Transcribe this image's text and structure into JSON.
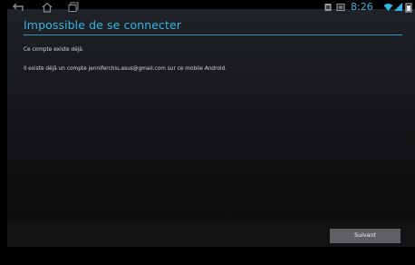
{
  "dialog": {
    "title": "Impossible de se connecter",
    "message_1": "Ce compte existe déjà.",
    "message_2": "Il existe déjà un compte jenniferchiu.asus@gmail.com sur ce mobile Android.",
    "next_button": "Suivant"
  },
  "status_bar": {
    "time": "8:26"
  },
  "colors": {
    "accent": "#33b5e5",
    "background": "#17191c",
    "button": "#5f6164"
  },
  "icons": [
    "back-icon",
    "home-icon",
    "recent-apps-icon",
    "notification-icon",
    "screenshot-icon",
    "wifi-icon",
    "signal-icon",
    "battery-icon"
  ]
}
